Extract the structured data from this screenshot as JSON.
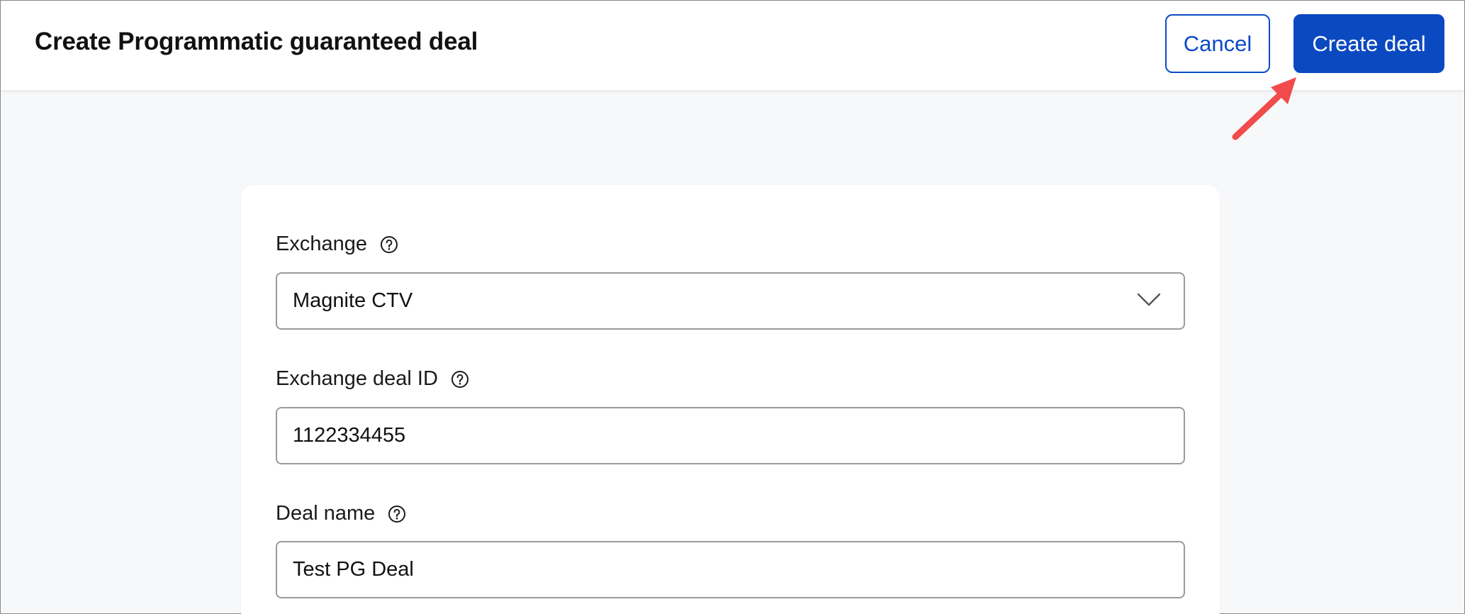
{
  "header": {
    "title": "Create Programmatic guaranteed deal",
    "cancel_label": "Cancel",
    "create_label": "Create deal"
  },
  "form": {
    "exchange": {
      "label": "Exchange",
      "value": "Magnite CTV",
      "icon": "chevron-down-icon",
      "help_icon": "help-circle-icon"
    },
    "exchange_deal_id": {
      "label": "Exchange deal ID",
      "value": "1122334455",
      "help_icon": "help-circle-icon"
    },
    "deal_name": {
      "label": "Deal name",
      "value": "Test PG Deal",
      "help_icon": "help-circle-icon"
    }
  },
  "colors": {
    "primary": "#0b49c0",
    "annotation_arrow": "#f24b4b",
    "page_background": "#f7f8fa"
  }
}
